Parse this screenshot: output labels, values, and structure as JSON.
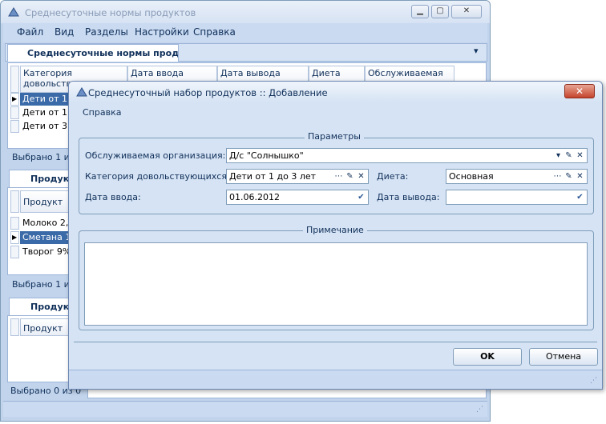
{
  "main_window": {
    "title": "Среднесуточные нормы продуктов",
    "menu": [
      "Файл",
      "Вид",
      "Разделы",
      "Настройки",
      "Справка"
    ],
    "doc_tab": "Среднесуточные нормы прод...",
    "grid_headers": [
      "Категория довольствую...",
      "Дата ввода",
      "Дата вывода",
      "Диета",
      "Обслуживаемая"
    ],
    "grid_rows": [
      "Дети от 1 д",
      "Дети от 1 д",
      "Дети от 3 д"
    ],
    "status_1": "Выбрано 1 из",
    "subtab_1": "Продукты",
    "subgrid_header": "Продукт",
    "products": [
      "Молоко 2,5",
      "Сметана 15",
      "Творог 9%"
    ],
    "status_2": "Выбрано 1 из",
    "subtab_2": "Продукты",
    "subgrid2_header": "Продукт",
    "status_3": "Выбрано 0 из 0"
  },
  "dialog": {
    "title": "Среднесуточный набор продуктов :: Добавление",
    "menu_help": "Справка",
    "params_group": "Параметры",
    "org_label": "Обслуживаемая организация:",
    "org_value": "Д/с \"Солнышко\"",
    "category_label": "Категория довольствующихся:",
    "category_value": "Дети от 1 до 3 лет",
    "diet_label": "Диета:",
    "diet_value": "Основная",
    "date_in_label": "Дата ввода:",
    "date_in_value": "01.06.2012",
    "date_out_label": "Дата вывода:",
    "date_out_value": "",
    "note_group": "Примечание",
    "ok": "OK",
    "cancel": "Отмена"
  }
}
